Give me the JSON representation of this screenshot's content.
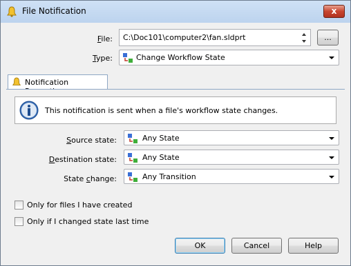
{
  "window": {
    "title": "File Notification",
    "close_label": "x"
  },
  "file": {
    "label_prefix": "",
    "label_key": "F",
    "label_rest": "ile:",
    "value": "C:\\Doc101\\computer2\\fan.sldprt",
    "browse_label": "..."
  },
  "type": {
    "label_key": "T",
    "label_rest": "ype:",
    "value": "Change Workflow State"
  },
  "tab": {
    "label": "Notification Properties"
  },
  "info": {
    "message": "This notification is sent when a file's workflow state changes."
  },
  "source_state": {
    "label_key": "S",
    "label_rest": "ource state:",
    "value": "Any State"
  },
  "destination_state": {
    "label_key": "D",
    "label_rest": "estination state:",
    "value": "Any State"
  },
  "state_change": {
    "label_pre": "State ",
    "label_key": "c",
    "label_rest": "hange:",
    "value": "Any Transition"
  },
  "checkboxes": {
    "created": {
      "label": "Only for files I have created",
      "checked": false
    },
    "changed": {
      "label": "Only if I changed state last time",
      "checked": false
    }
  },
  "buttons": {
    "ok": "OK",
    "cancel": "Cancel",
    "help": "Help"
  },
  "colors": {
    "title_bar": "#c5daf2",
    "close_button": "#c7452f",
    "tab_border": "#8ea7c4"
  }
}
